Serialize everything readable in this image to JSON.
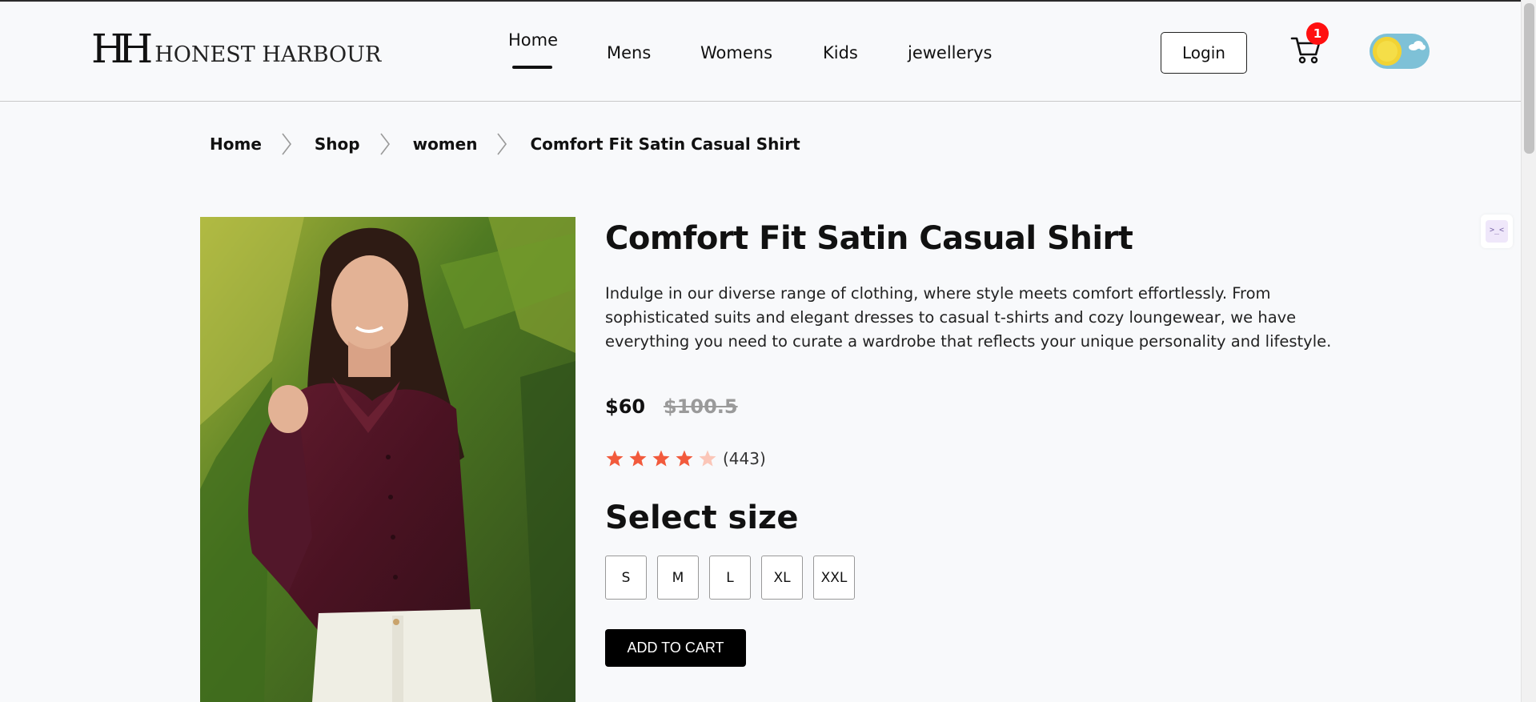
{
  "brand": {
    "mark": "HH",
    "name": "HONEST HARBOUR"
  },
  "nav": {
    "items": [
      {
        "label": "Home",
        "active": true
      },
      {
        "label": "Mens"
      },
      {
        "label": "Womens"
      },
      {
        "label": "Kids"
      },
      {
        "label": "jewellerys"
      }
    ]
  },
  "header": {
    "login_label": "Login",
    "cart_count": "1",
    "theme_toggle": "light"
  },
  "breadcrumb": [
    "Home",
    "Shop",
    "women",
    "Comfort Fit Satin Casual Shirt"
  ],
  "product": {
    "title": "Comfort Fit Satin Casual Shirt",
    "description": "Indulge in our diverse range of clothing, where style meets comfort effortlessly. From sophisticated suits and elegant dresses to casual t-shirts and cozy loungewear, we have everything you need to curate a wardrobe that reflects your unique personality and lifestyle.",
    "price": "$60",
    "old_price": "$100.5",
    "rating": 4,
    "rating_max": 5,
    "rating_count": "(443)",
    "size_heading": "Select size",
    "sizes": [
      "S",
      "M",
      "L",
      "XL",
      "XXL"
    ],
    "add_to_cart_label": "ADD TO CART"
  },
  "colors": {
    "star_filled": "#f25a3c",
    "star_empty": "#fbc6b8",
    "cart_badge": "#ff1010",
    "button_bg": "#000000"
  }
}
